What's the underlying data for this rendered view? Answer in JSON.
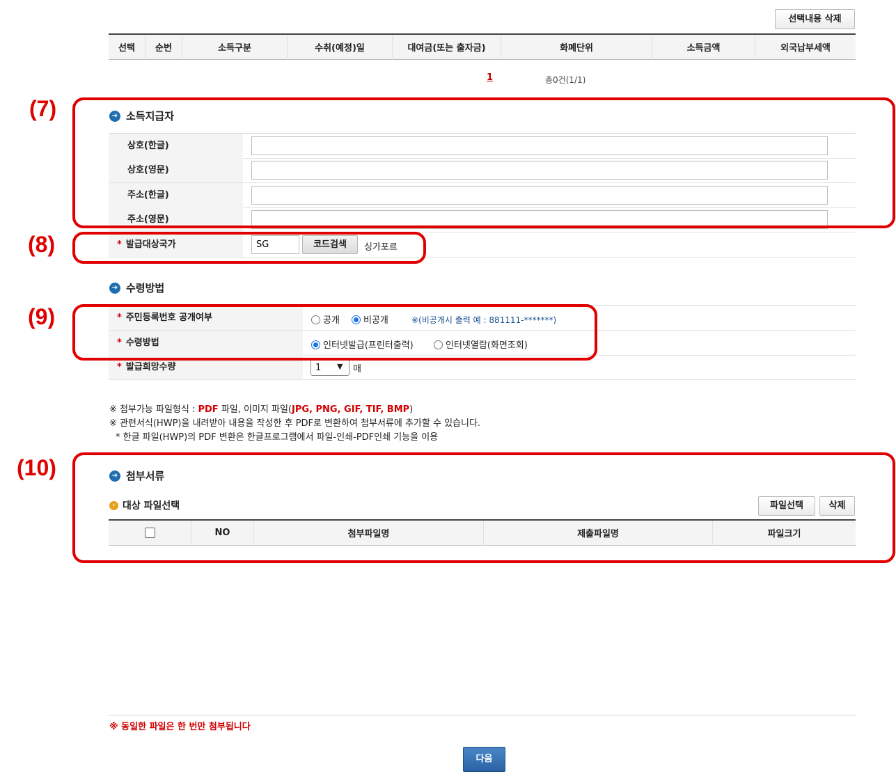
{
  "top": {
    "delete_selected": "선택내용 삭제",
    "columns": [
      "선택",
      "순번",
      "소득구분",
      "수취(예정)일",
      "대여금(또는 출자금)",
      "화폐단위",
      "소득금액",
      "외국납부세액"
    ],
    "page_link": "1",
    "page_total": "총0건(1/1)"
  },
  "payer": {
    "title": "소득지급자",
    "rows": [
      {
        "label": "상호(한글)",
        "value": ""
      },
      {
        "label": "상호(영문)",
        "value": ""
      },
      {
        "label": "주소(한글)",
        "value": ""
      },
      {
        "label": "주소(영문)",
        "value": ""
      }
    ],
    "country_label": "발급대상국가",
    "country_code": "SG",
    "code_search": "코드검색",
    "country_name": "싱가포르"
  },
  "receipt": {
    "title": "수령방법",
    "rrn_label": "주민등록번호 공개여부",
    "rrn_options": [
      "공개",
      "비공개"
    ],
    "rrn_selected": "비공개",
    "rrn_note": "※(비공개시 출력 예 : 881111-*******)",
    "method_label": "수령방법",
    "method_options": [
      "인터넷발급(프린터출력)",
      "인터넷열람(화면조회)"
    ],
    "method_selected": "인터넷발급(프린터출력)",
    "qty_label": "발급희망수량",
    "qty_value": "1",
    "qty_unit": "매"
  },
  "notes": {
    "line1_prefix": "※ 첨부가능 파일형식 : ",
    "line1_pdf": "PDF",
    "line1_mid": " 파일, 이미지 파일(",
    "line1_types": "JPG, PNG, GIF, TIF, BMP",
    "line1_suffix": ")",
    "line2": "※ 관련서식(HWP)을 내려받아 내용을 작성한 후 PDF로 변환하여 첨부서류에 추가할 수 있습니다.",
    "line3": "* 한글 파일(HWP)의 PDF 변환은 한글프로그램에서 파일-인쇄-PDF인쇄 기능을 이용"
  },
  "attach": {
    "title": "첨부서류",
    "subtitle": "대상 파일선택",
    "select_file": "파일선택",
    "delete": "삭제",
    "columns": [
      "",
      "NO",
      "첨부파일명",
      "제출파일명",
      "파일크기"
    ]
  },
  "footer": {
    "warning": "※ 동일한 파일은 한 번만 첨부됩니다",
    "next": "다음"
  },
  "markers": [
    "(7)",
    "(8)",
    "(9)",
    "(10)"
  ],
  "colors": {
    "highlight": "#e00000",
    "primary_button": "#2f6fb5",
    "required": "#d10000"
  }
}
